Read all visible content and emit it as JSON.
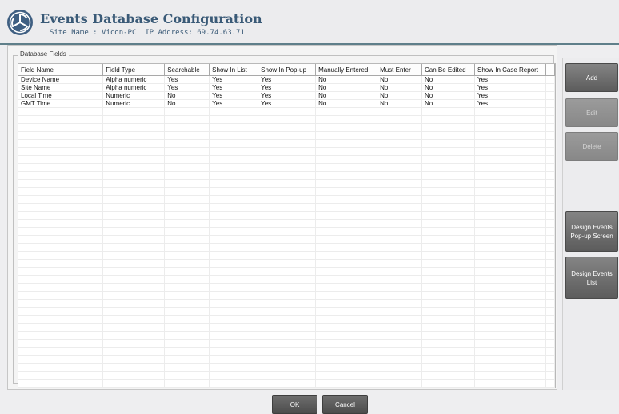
{
  "header": {
    "title": "Events Database Configuration",
    "site_label": "Site Name : ",
    "site_name": "Vicon-PC",
    "ip_label": "IP Address:",
    "ip_address": "69.74.63.71"
  },
  "group_label": "Database Fields",
  "table": {
    "columns": [
      "Field Name",
      "Field Type",
      "Searchable",
      "Show In List",
      "Show In Pop-up",
      "Manually Entered",
      "Must Enter",
      "Can Be Edited",
      "Show In Case Report"
    ],
    "rows": [
      [
        "Device Name",
        "Alpha numeric",
        "Yes",
        "Yes",
        "Yes",
        "No",
        "No",
        "No",
        "Yes"
      ],
      [
        "Site Name",
        "Alpha numeric",
        "Yes",
        "Yes",
        "Yes",
        "No",
        "No",
        "No",
        "Yes"
      ],
      [
        "Local Time",
        "Numeric",
        "No",
        "Yes",
        "Yes",
        "No",
        "No",
        "No",
        "Yes"
      ],
      [
        "GMT Time",
        "Numeric",
        "No",
        "Yes",
        "Yes",
        "No",
        "No",
        "No",
        "Yes"
      ]
    ]
  },
  "side_buttons": {
    "add": "Add",
    "edit": "Edit",
    "delete": "Delete",
    "design_popup": "Design Events Pop-up Screen",
    "design_list": "Design Events List"
  },
  "footer": {
    "ok": "OK",
    "cancel": "Cancel"
  },
  "colors": {
    "title": "#3a5a77",
    "header_rule": "#5f7f8a"
  },
  "icons": {
    "logo": "vicon-logo-icon"
  }
}
